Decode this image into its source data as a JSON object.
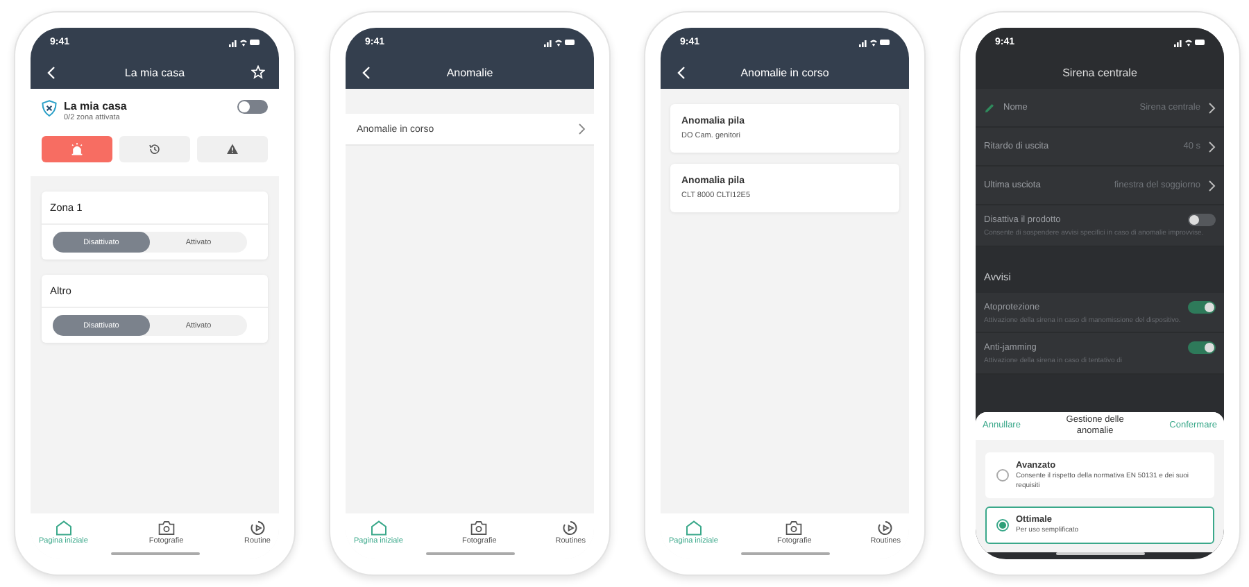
{
  "phones": [
    {
      "kind": "home",
      "time": "9:41",
      "title": "La mia casa",
      "home": {
        "name": "La mia casa",
        "subtitle": "0/2 zona attivata",
        "on": false
      },
      "actions": [
        {
          "kind": "siren",
          "selected": true
        },
        {
          "kind": "history",
          "selected": false
        },
        {
          "kind": "warning",
          "selected": false
        }
      ],
      "zones": [
        {
          "name": "Zona 1",
          "options": [
            {
              "label": "Disattivato",
              "selected": true
            },
            {
              "label": "Attivato",
              "selected": false
            }
          ]
        },
        {
          "name": "Altro",
          "options": [
            {
              "label": "Disattivato",
              "selected": true
            },
            {
              "label": "Attivato",
              "selected": false
            }
          ]
        }
      ],
      "nav": [
        {
          "kind": "home",
          "label": "Pagina iniziale",
          "selected": true
        },
        {
          "kind": "camera",
          "label": "Fotografie",
          "selected": false
        },
        {
          "kind": "routine",
          "label": "Routine",
          "selected": false
        }
      ]
    },
    {
      "kind": "list",
      "time": "9:41",
      "title": "Anomalie",
      "items": [
        {
          "label": "Anomalie in corso"
        }
      ],
      "nav": [
        {
          "kind": "home",
          "label": "Pagina iniziale",
          "selected": true
        },
        {
          "kind": "camera",
          "label": "Fotografie",
          "selected": false
        },
        {
          "kind": "routine",
          "label": "Routines",
          "selected": false
        }
      ]
    },
    {
      "kind": "cards",
      "time": "9:41",
      "title": "Anomalie in corso",
      "cards": [
        {
          "title": "Anomalia pila",
          "subtitle": "DO Cam. genitori"
        },
        {
          "title": "Anomalia pila",
          "subtitle": "CLT 8000 CLTI12E5"
        }
      ],
      "nav": [
        {
          "kind": "home",
          "label": "Pagina iniziale",
          "selected": true
        },
        {
          "kind": "camera",
          "label": "Fotografie",
          "selected": false
        },
        {
          "kind": "routine",
          "label": "Routines",
          "selected": false
        }
      ]
    },
    {
      "kind": "settings",
      "time": "9:41",
      "title": "Sirena centrale",
      "rows": [
        {
          "kind": "link",
          "label": "Nome",
          "value": "Sirena centrale",
          "editable": true
        },
        {
          "kind": "link",
          "label": "Ritardo di uscita",
          "value": "40 s",
          "editable": false
        },
        {
          "kind": "link",
          "label": "Ultima usciota",
          "value": "finestra del soggiorno",
          "editable": false
        },
        {
          "kind": "toggle",
          "label": "Disattiva il prodotto",
          "on": false,
          "description": "Consente di sospendere avvisi specifici in caso di anomalie improvvise."
        },
        {
          "kind": "section",
          "label": "Avvisi"
        },
        {
          "kind": "toggle",
          "label": "Atoprotezione",
          "on": true,
          "description": "Attivazione della sirena in caso di manomissione del dispositivo."
        },
        {
          "kind": "toggle",
          "label": "Anti-jamming",
          "on": true,
          "description": "Attivazione della sirena in caso di tentativo di"
        }
      ],
      "sheet": {
        "cancel": "Annullare",
        "title": "Gestione delle anomalie",
        "confirm": "Confermare",
        "options": [
          {
            "title": "Avanzato",
            "description": "Consente il rispetto della normativa EN 50131 e dei suoi requisiti",
            "selected": false
          },
          {
            "title": "Ottimale",
            "description": "Per uso semplificato",
            "selected": true
          }
        ]
      }
    }
  ]
}
